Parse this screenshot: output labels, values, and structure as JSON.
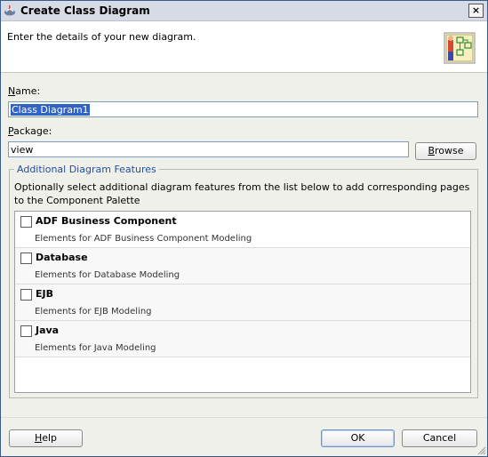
{
  "window": {
    "title": "Create Class Diagram",
    "close_glyph": "×"
  },
  "header": {
    "text": "Enter the details of your new diagram.",
    "icon": "class-diagram-icon"
  },
  "name_field": {
    "label_mnemonic": "N",
    "label_rest": "ame:",
    "value": "Class Diagram1"
  },
  "package_field": {
    "label_mnemonic": "P",
    "label_rest": "ackage:",
    "value": "view"
  },
  "browse_button": {
    "mnemonic": "B",
    "rest": "rowse"
  },
  "features": {
    "legend": "Additional Diagram Features",
    "description": "Optionally select additional diagram features from the list below to add corresponding pages to the Component Palette",
    "items": [
      {
        "title": "ADF Business Component",
        "desc": "Elements for ADF Business Component Modeling",
        "checked": false
      },
      {
        "title": "Database",
        "desc": "Elements for Database Modeling",
        "checked": false
      },
      {
        "title": "EJB",
        "desc": "Elements for EJB Modeling",
        "checked": false
      },
      {
        "title": "Java",
        "desc": "Elements for Java Modeling",
        "checked": false
      }
    ]
  },
  "footer": {
    "help": {
      "mnemonic": "H",
      "rest": "elp"
    },
    "ok": "OK",
    "cancel": "Cancel"
  },
  "colors": {
    "selection": "#3163c5",
    "legend": "#234e9c",
    "field_border": "#7f9db9"
  }
}
